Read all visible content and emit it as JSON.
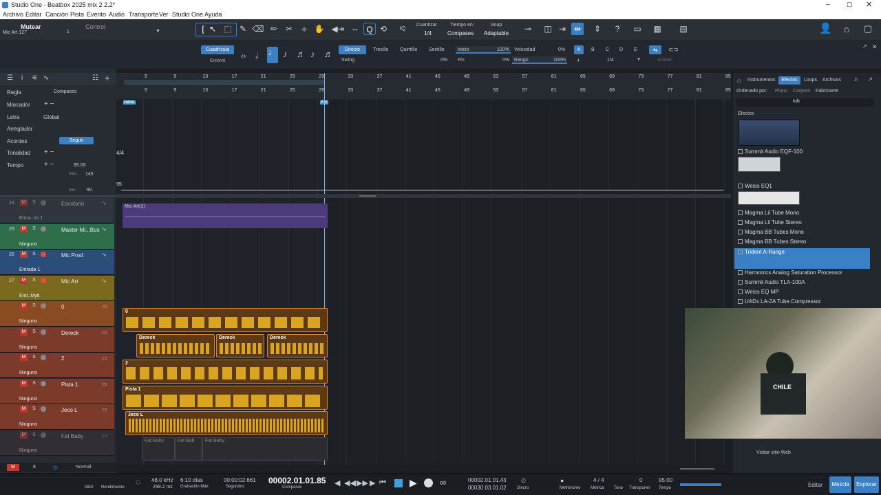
{
  "window": {
    "title": "Studio One - Beatbox 2025 mix 2 2.2*"
  },
  "menu": [
    "Archivo",
    "Editar",
    "Canción",
    "Pista",
    "Evento",
    "Audio",
    "Transporte",
    "Ver",
    "Studio One",
    "Ayuda"
  ],
  "toolbar": {
    "track_title": "Mutear",
    "track_sub": "Mic Art 127",
    "track_num": "1",
    "control_label": "Control"
  },
  "quantize": {
    "cuantizar_label": "Cuantizar",
    "cuantizar_value": "1/4",
    "tiempo_label": "Tiempo en:",
    "tiempo_value": "Compases",
    "snap_label": "Snap",
    "snap_value": "Adaptable",
    "cuadricula": "Cuadrícula",
    "groove": "Groove",
    "directo": "Directo",
    "tresillo": "Tresillo",
    "quintillo": "Quintillo",
    "sextillo": "Sextillo",
    "swing": "Swing",
    "swing_val": "0%",
    "inicio": "Inicio",
    "inicio_val": "100%",
    "fin": "Fin",
    "fin_val": "0%",
    "velocidad": "Velocidad",
    "velocidad_val": "0%",
    "rango": "Rango",
    "rango_val": "100%",
    "letters": [
      "A",
      "B",
      "C",
      "D",
      "E"
    ],
    "grid_val": "1/4",
    "activar": "Activar"
  },
  "global_tracks": {
    "regla": "Regla",
    "regla_val": "Compases",
    "marcador": "Marcador",
    "letra": "Letra",
    "letra_val": "Global",
    "arreglador": "Arreglador",
    "acordes": "Acordes",
    "seguir": "Seguir",
    "tonalidad": "Tonalidad",
    "tempo": "Tempo",
    "tempo_val": "95.00",
    "max": "max",
    "max_val": "145",
    "min": "min",
    "min_val": "90",
    "sig": "4/4",
    "tempo_line": "95"
  },
  "ruler": [
    "5",
    "9",
    "13",
    "17",
    "21",
    "25",
    "29",
    "33",
    "37",
    "41",
    "45",
    "49",
    "53",
    "57",
    "61",
    "65",
    "69",
    "73",
    "77",
    "81",
    "85"
  ],
  "markers": {
    "start": "Inicio",
    "end": "Fin"
  },
  "tracks": [
    {
      "num": "24",
      "name": "Escritorio",
      "input": "Entra..no 1",
      "mono": "Mono",
      "color": "#3a3f48",
      "dim": true
    },
    {
      "num": "25",
      "name": "Master Mi...Bus",
      "input": "Ninguno",
      "mono": "",
      "color": "#2f6e4a",
      "dim": false
    },
    {
      "num": "26",
      "name": "Mic Prod",
      "input": "Entrada 1",
      "mono": "Mono",
      "color": "#2b4d7a",
      "dim": false
    },
    {
      "num": "27",
      "name": "Mic Art",
      "input": "Entr..Mytt",
      "mono": "Mono",
      "color": "#7a6a1e",
      "dim": false
    },
    {
      "num": "",
      "name": "0",
      "input": "Ninguno",
      "mono": "",
      "color": "#8a4a22",
      "dim": false
    },
    {
      "num": "",
      "name": "Dereck",
      "input": "Ninguno",
      "mono": "",
      "color": "#7b3a2a",
      "dim": false
    },
    {
      "num": "",
      "name": "2",
      "input": "Ninguno",
      "mono": "",
      "color": "#7b3a2a",
      "dim": false
    },
    {
      "num": "",
      "name": "Pista 1",
      "input": "Ninguno",
      "mono": "",
      "color": "#7b3a2a",
      "dim": false
    },
    {
      "num": "",
      "name": "Jeco L",
      "input": "Ninguno",
      "mono": "",
      "color": "#7b3a2a",
      "dim": false
    },
    {
      "num": "",
      "name": "Fat Baby",
      "input": "Ninguno",
      "mono": "",
      "color": "#3d3135",
      "dim": true
    }
  ],
  "clips": {
    "mic_art": "Mic Art(2)",
    "zero": "0",
    "dereck": [
      "Dereck",
      "Dereck",
      "Dereck"
    ],
    "two": "2",
    "pista1": "Pista 1",
    "jeco": "Jeco L",
    "fatbaby": [
      "Fat Baby",
      "Fat Bab",
      "Fat Baby"
    ]
  },
  "bottom_left": {
    "normal": "Normal",
    "count": "8",
    "top": "Ningúno"
  },
  "browser": {
    "tabs": [
      "Instrumentos",
      "Efectos",
      "Loops",
      "Archivos"
    ],
    "sort_label": "Ordenado por:",
    "sort_opts": [
      "Plano",
      "Carpeta",
      "Fabricante"
    ],
    "search": "tub",
    "section": "Efectos",
    "items": [
      "Summit Audio EQF-100",
      "Weiss EQ1",
      "Magma Lil Tube Mono",
      "Magma Lil Tube Stereo",
      "Magma BB Tubes Mono",
      "Magma BB Tubes Stereo",
      "Trident A-Range",
      "Harmonics Analog Saturation Processor",
      "Summit Audio TLA-100A",
      "Weiss EQ MP",
      "UADx LA-2A Tube Compressor"
    ],
    "visit": "Visitar sitio Web"
  },
  "transport": {
    "midi": "MIDI",
    "rendimiento": "Rendimiento",
    "sample_rate": "48.0 kHz",
    "sample_sub": "299.2 ms",
    "days": "6:10 días",
    "days_sub": "Grabación Máx",
    "time": "00:00:02.661",
    "time_sub": "Segundos",
    "position": "00002.01.01.85",
    "position_sub": "Compases",
    "loop_l": "00002.01.01.43",
    "loop_r": "00030.03.01.02",
    "sinc": "Sincro",
    "metronomo": "Metrónomo",
    "metrica": "4 / 4",
    "metrica_label": "Métrica",
    "tono_label": "Tono",
    "transponer": "0",
    "transponer_label": "Transponer",
    "tempo": "95.00",
    "tempo_label": "Tempo",
    "editar": "Editar",
    "mezcla": "Mezcla",
    "explorar": "Explorar"
  },
  "colors": {
    "accent": "#3b7fc4",
    "clip_gold": "#d9a520",
    "clip_orange": "#e0802a",
    "purple": "#4b3b7a"
  }
}
